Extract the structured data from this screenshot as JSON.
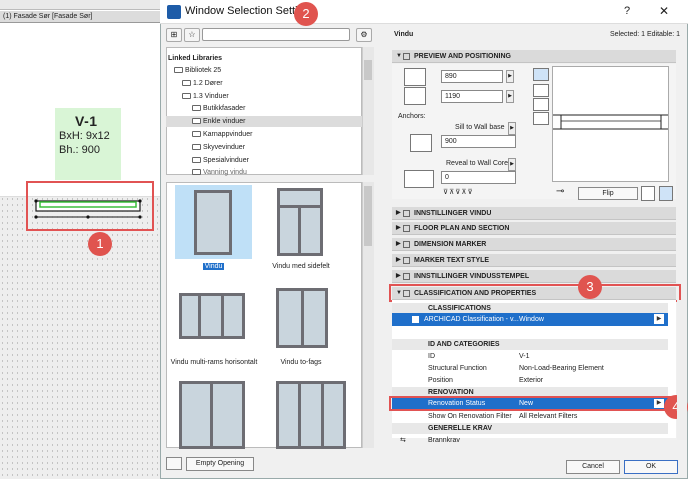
{
  "plan": {
    "tab": "(1) Fasade Sør [Fasade Sør]",
    "id": "V-1",
    "bxh": "BxH: 9x12",
    "bh": "Bh.: 900"
  },
  "dialog": {
    "title": "Window Selection Settings",
    "help": "?",
    "close": "✕"
  },
  "tree": [
    "Linked Libraries",
    "Bibliotek 25",
    "1.2 Dører",
    "1.3 Vinduer",
    "Butikkfasader",
    "Enkle vinduer",
    "Karnappvinduer",
    "Skyvevinduer",
    "Spesialvinduer",
    "Vanning vindu"
  ],
  "gallery": [
    "Vindu",
    "Vindu med sidefelt",
    "Vindu multi-rams horisontalt",
    "Vindu to-fags",
    "",
    ""
  ],
  "left_buttons": {
    "empty": "Empty Opening"
  },
  "right": {
    "name": "Vindu",
    "selected": "Selected: 1 Editable: 1",
    "sections": [
      "PREVIEW AND POSITIONING",
      "INNSTILLINGER VINDU",
      "FLOOR PLAN AND SECTION",
      "DIMENSION MARKER",
      "MARKER TEXT STYLE",
      "INNSTILLINGER VINDUSSTEMPEL",
      "CLASSIFICATION AND PROPERTIES"
    ],
    "width": "890",
    "height": "1190",
    "anchors": "Anchors:",
    "sill": "Sill to Wall base",
    "sill_val": "900",
    "reveal": "Reveal to Wall Core",
    "reveal_val": "0",
    "flip": "Flip",
    "classifications": "CLASSIFICATIONS",
    "cls_value_key": "ARCHICAD Classification - v...",
    "cls_value": "Window",
    "idcat": "ID AND CATEGORIES",
    "rows": [
      {
        "k": "ID",
        "v": "V-1"
      },
      {
        "k": "Structural Function",
        "v": "Non-Load-Bearing Element"
      },
      {
        "k": "Position",
        "v": "Exterior"
      }
    ],
    "renovation": "RENOVATION",
    "ren_status": "Renovation Status",
    "ren_val": "New",
    "ren_filter": "Show On Renovation Filter",
    "ren_filter_val": "All Relevant Filters",
    "generelle": "GENERELLE KRAV",
    "brannkrav": "Brannkrav"
  },
  "buttons": {
    "cancel": "Cancel",
    "ok": "OK"
  },
  "badges": [
    "1",
    "2",
    "3",
    "4"
  ]
}
